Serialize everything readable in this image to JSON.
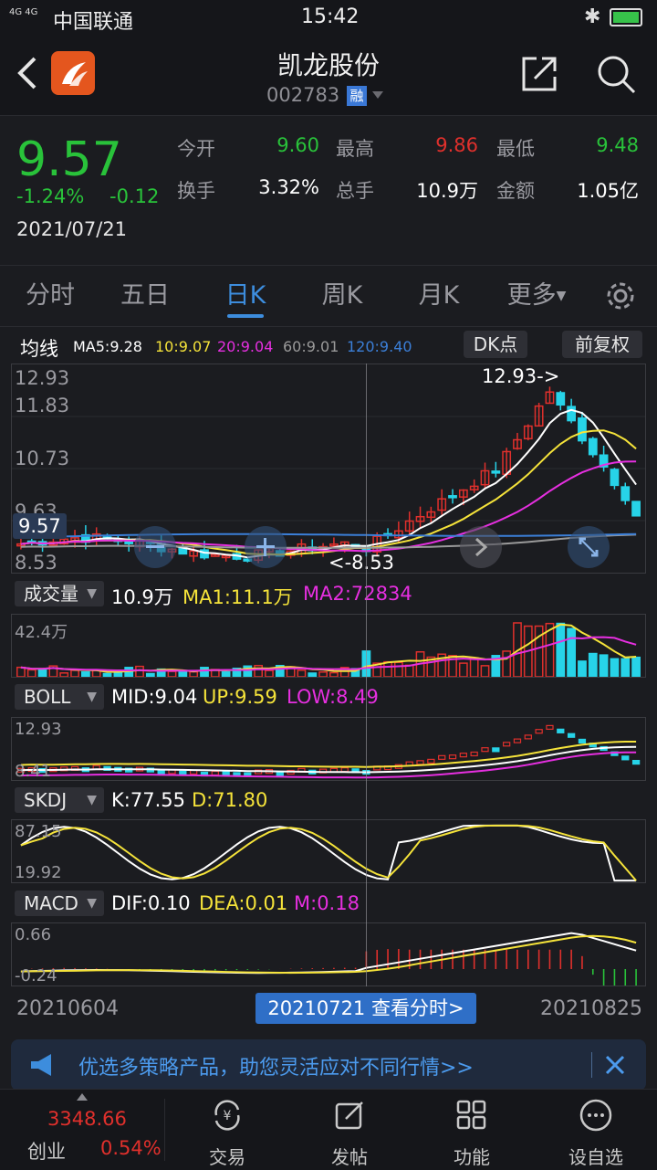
{
  "status_bar": {
    "network": "4G 4G",
    "carrier": "中国联通",
    "time": "15:42"
  },
  "header": {
    "name": "凯龙股份",
    "code": "002783",
    "margin_badge": "融"
  },
  "quote": {
    "price": "9.57",
    "change_pct": "-1.24%",
    "change": "-0.12",
    "date": "2021/07/21",
    "stats": [
      {
        "label": "今开",
        "value": "9.60",
        "color": "#29c23a"
      },
      {
        "label": "最高",
        "value": "9.86",
        "color": "#e0302c"
      },
      {
        "label": "最低",
        "value": "9.48",
        "color": "#29c23a"
      },
      {
        "label": "换手",
        "value": "3.32%",
        "color": "#ffffff"
      },
      {
        "label": "总手",
        "value": "10.9万",
        "color": "#ffffff"
      },
      {
        "label": "金额",
        "value": "1.05亿",
        "color": "#ffffff"
      }
    ]
  },
  "tabs": [
    "分时",
    "五日",
    "日K",
    "周K",
    "月K",
    "更多"
  ],
  "active_tab": "日K",
  "ma_bar": {
    "label": "均线",
    "ma5": "MA5:9.28",
    "ma10": "10:9.07",
    "ma20": "20:9.04",
    "ma60": "60:9.01",
    "ma120": "120:9.40",
    "dk_button": "DK点",
    "adjust_button": "前复权"
  },
  "kline": {
    "axis_top": "12.93",
    "axis_2": "11.83",
    "axis_3": "10.73",
    "axis_4": "9.63",
    "axis_bottom": "8.53",
    "current_price": "9.57",
    "high_marker": "12.93->",
    "low_marker": "<-8.53"
  },
  "volume": {
    "selector": "成交量",
    "value": "10.9万",
    "ma1": "MA1:11.1万",
    "ma2": "MA2:72834",
    "axis_top": "42.4万"
  },
  "boll": {
    "selector": "BOLL",
    "mid": "MID:9.04",
    "up": "UP:9.59",
    "low": "LOW:8.49",
    "axis_top": "12.93",
    "axis_bottom": "8.41"
  },
  "skdj": {
    "selector": "SKDJ",
    "k": "K:77.55",
    "d": "D:71.80",
    "axis_top": "87.15",
    "axis_bottom": "19.92"
  },
  "macd": {
    "selector": "MACD",
    "dif": "DIF:0.10",
    "dea": "DEA:0.01",
    "m": "M:0.18",
    "axis_top": "0.66",
    "axis_bottom": "-0.24"
  },
  "dates": {
    "start": "20210604",
    "cursor": "20210721 查看分时>",
    "end": "20210825"
  },
  "banner": {
    "text": "优选多策略产品，助您灵活应对不同行情>>"
  },
  "bottom_nav": {
    "index_value": "3348.66",
    "index_name": "创业",
    "index_change": "0.54%",
    "items": [
      "交易",
      "发帖",
      "功能",
      "设自选"
    ]
  },
  "colors": {
    "up": "#e0302c",
    "down": "#27d3e8",
    "green": "#29c23a",
    "accent": "#3d8ddd",
    "ma5": "#ffffff",
    "ma10": "#f5e33a",
    "ma20": "#e62fe0",
    "ma60": "#9a9a9a",
    "ma120": "#3b7fd8"
  }
}
